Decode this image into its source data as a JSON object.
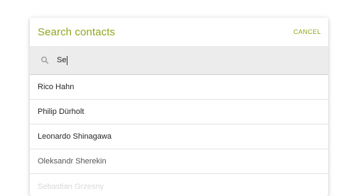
{
  "dialog": {
    "title": "Search contacts",
    "cancel_label": "CANCEL"
  },
  "search": {
    "value": "Se",
    "icon": "search-icon"
  },
  "contacts": [
    "Rico Hahn",
    "Philip Dürholt",
    "Leonardo Shinagawa",
    "Oleksandr Sherekin",
    "Sebastian Grzesny"
  ],
  "colors": {
    "accent": "#93a51d",
    "search_bg": "#ececec"
  }
}
